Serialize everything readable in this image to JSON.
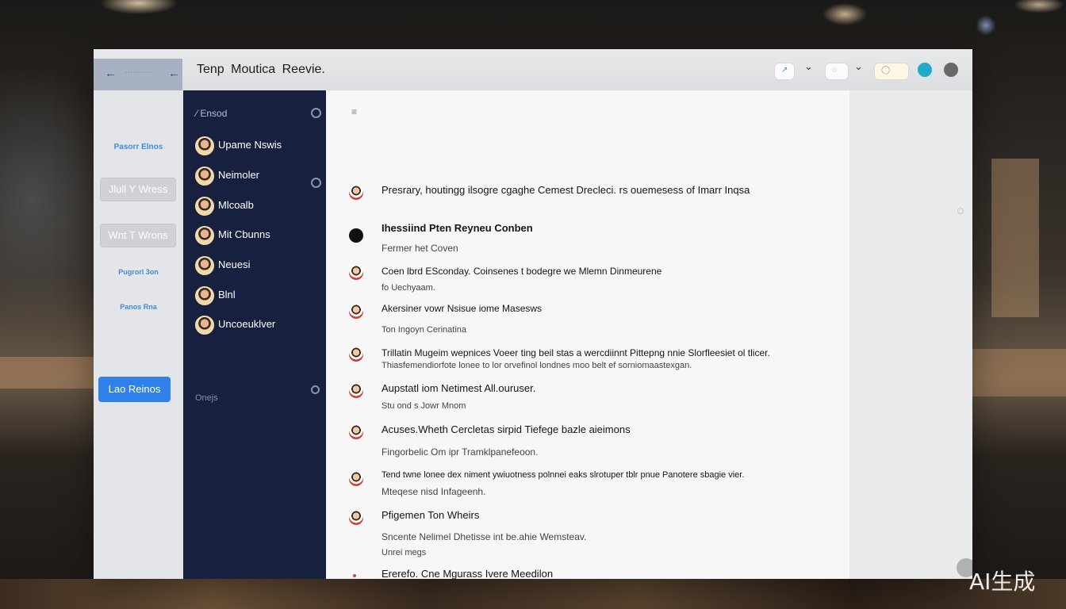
{
  "window": {
    "title": "Tenp  Moutica Reevie."
  },
  "sidebar": {
    "links": [
      {
        "label": "Pasorr Elnos",
        "top": 0
      },
      {
        "label": "Pugrorl 3on"
      },
      {
        "label": "Panos Rna"
      }
    ],
    "buttons": [
      "Jlull Y Wress",
      "Wnt T Wrons"
    ],
    "primary": "Lao Reinos"
  },
  "contacts": {
    "header": "Ensod",
    "items": [
      "Upame Nswis",
      "Neimoler",
      "Mlcoalb",
      "Mit Cbunns",
      "Neuesi",
      "Blnl",
      "Uncoeuklver"
    ],
    "footer": "Onejs"
  },
  "main": {
    "menu_mark": "≡",
    "messages": [
      {
        "line1": "Presrary, houtingg ilsogre cgaghe Cemest Drecleci.  rs ouemesess of Imarr Inqsa",
        "bold": false,
        "avatar": "person"
      },
      {
        "line1": "Ihessiind Pten Reyneu Conben",
        "line2": "Fermer het Coven",
        "bold": true,
        "avatar": "black"
      },
      {
        "line1": "Coen lbrd ESconday.   Coinsenes t bodegre we Mlemn Dinmeurene",
        "line2": "fo Uechyaam.",
        "bold": false,
        "avatar": "person"
      },
      {
        "line1": "Akersiner vowr Nsisue iome Masesws",
        "line2": "Ton Ingoyn Cerinatina",
        "bold": false,
        "avatar": "person"
      },
      {
        "line1": "Trillatin Mugeim wepnices Voeer ting beil stas a wercdiinnt Pittepng nnie Slorfleesiet ol tlicer.",
        "line2": "Thiasfemendiorfote lonee to lor orvefinol londnes moo belt ef sorniomaastexgan.",
        "bold": false,
        "avatar": "person"
      },
      {
        "line1": "Aupstatl iom Netimest   All.ouruser.",
        "line2": "Stu ond s Jowr Mnom",
        "bold": false,
        "avatar": "person"
      },
      {
        "line1": "Acuses.Wheth Cercletas sirpid Tiefege bazle aieimons",
        "line2": "Fingorbelic Om ipr Tramklpanefeoon.",
        "bold": false,
        "avatar": "person"
      },
      {
        "line1": "Tend twne lonee dex niment ywiuotness polnnei eaks slrotuper tblr pnue Panotere sbagie vier.",
        "line2": "Mteqese nisd Infageenh.",
        "bold": false,
        "avatar": "person"
      },
      {
        "line1": "Pfigemen Ton Wheirs",
        "line2": "Sncente Nelimel Dhetisse  int be.ahie Wemsteav.",
        "line3": "Unrei megs",
        "bold": false,
        "avatar": "person"
      },
      {
        "line1": "Ererefo.  Cne  Mgurass Ivere Meedilon",
        "bold": false,
        "avatar": "tiny"
      }
    ]
  },
  "watermark": "AI生成"
}
